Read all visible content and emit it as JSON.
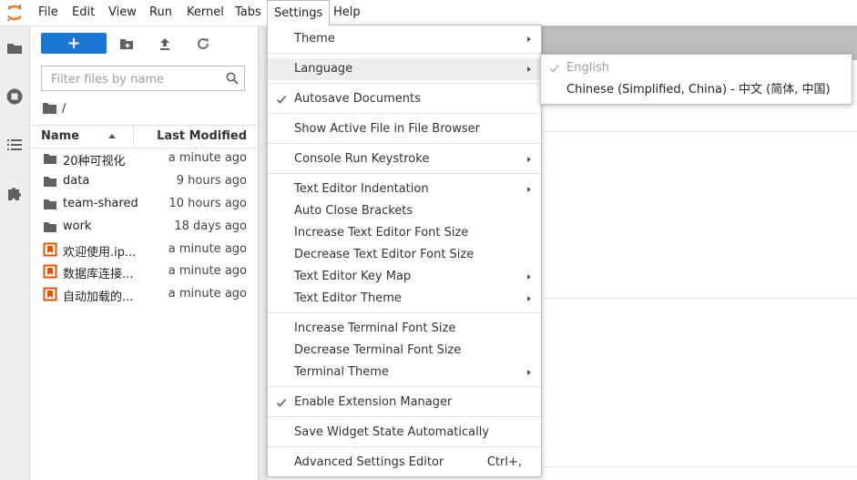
{
  "menubar": {
    "items": [
      {
        "label": "File"
      },
      {
        "label": "Edit"
      },
      {
        "label": "View"
      },
      {
        "label": "Run"
      },
      {
        "label": "Kernel"
      },
      {
        "label": "Tabs"
      },
      {
        "label": "Settings",
        "active": true
      },
      {
        "label": "Help"
      }
    ]
  },
  "rail": {
    "icons": [
      "folder-icon",
      "running-icon",
      "toc-icon",
      "extension-icon"
    ]
  },
  "filebrowser": {
    "new_button_label": "+",
    "filter_placeholder": "Filter files by name",
    "breadcrumb": "/",
    "columns": {
      "name": "Name",
      "modified": "Last Modified"
    },
    "files": [
      {
        "name": "20种可视化",
        "type": "folder",
        "modified": "a minute ago"
      },
      {
        "name": "data",
        "type": "folder",
        "modified": "9 hours ago"
      },
      {
        "name": "team-shared",
        "type": "folder",
        "modified": "10 hours ago"
      },
      {
        "name": "work",
        "type": "folder",
        "modified": "18 days ago"
      },
      {
        "name": "欢迎使用.ip...",
        "type": "notebook",
        "modified": "a minute ago"
      },
      {
        "name": "数据库连接...",
        "type": "notebook",
        "modified": "a minute ago"
      },
      {
        "name": "自动加载的...",
        "type": "notebook",
        "modified": "a minute ago"
      }
    ]
  },
  "settings_menu": {
    "items": {
      "theme": "Theme",
      "language": "Language",
      "autosave": "Autosave Documents",
      "show_active_file": "Show Active File in File Browser",
      "console_run_keystroke": "Console Run Keystroke",
      "text_editor_indentation": "Text Editor Indentation",
      "auto_close_brackets": "Auto Close Brackets",
      "increase_editor_font": "Increase Text Editor Font Size",
      "decrease_editor_font": "Decrease Text Editor Font Size",
      "text_editor_key_map": "Text Editor Key Map",
      "text_editor_theme": "Text Editor Theme",
      "increase_terminal_font": "Increase Terminal Font Size",
      "decrease_terminal_font": "Decrease Terminal Font Size",
      "terminal_theme": "Terminal Theme",
      "enable_extension_manager": "Enable Extension Manager",
      "save_widget_state": "Save Widget State Automatically",
      "advanced_settings_editor": "Advanced Settings Editor",
      "advanced_settings_shortcut": "Ctrl+,"
    }
  },
  "language_submenu": {
    "items": [
      {
        "label": "English",
        "checked": true,
        "disabled": true
      },
      {
        "label": "Chinese (Simplified, China) - 中文 (简体, 中国)",
        "checked": false,
        "disabled": false
      }
    ]
  },
  "colors": {
    "accent": "#1976d2",
    "notebook_icon": "#e65100",
    "logo": "#f37726"
  }
}
